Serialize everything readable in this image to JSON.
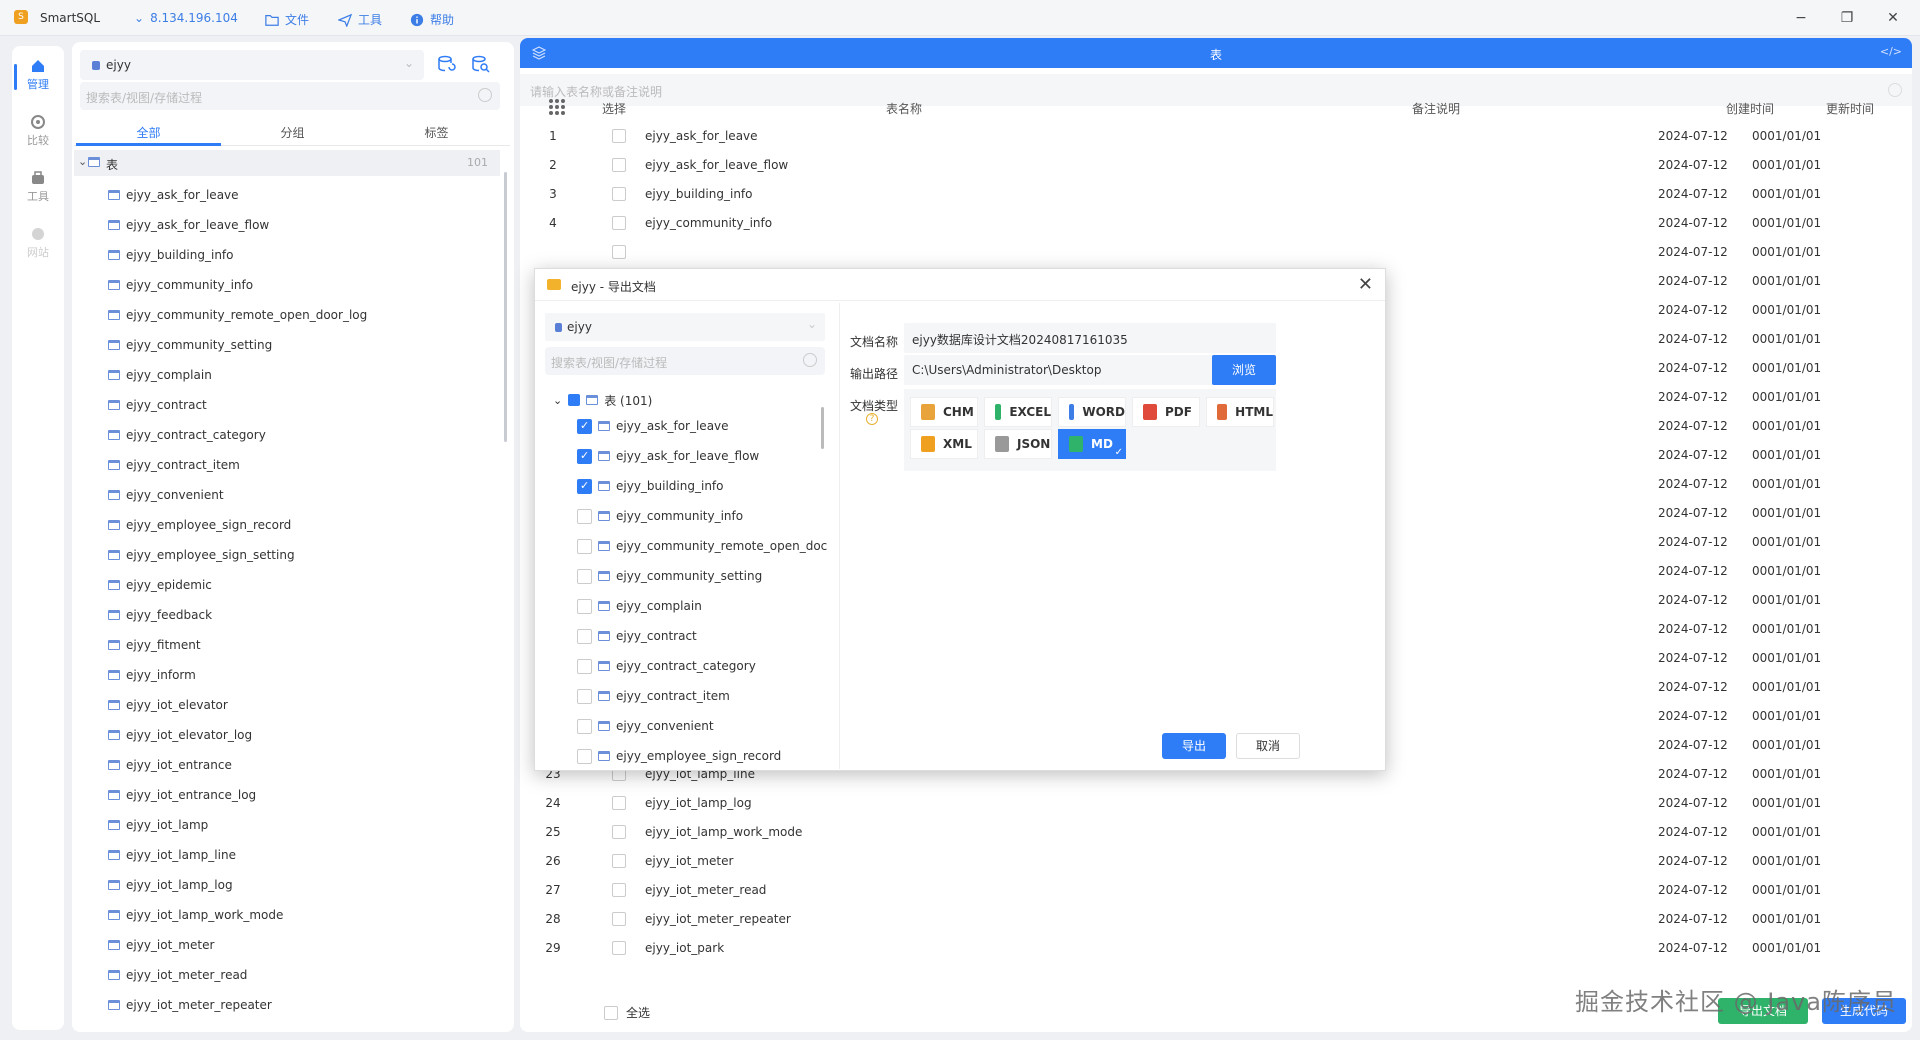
{
  "app": {
    "name": "SmartSQL",
    "connection": "8.134.196.104",
    "menu": [
      "文件",
      "工具",
      "帮助"
    ]
  },
  "sidenav": [
    {
      "label": "管理",
      "icon": "home-icon"
    },
    {
      "label": "比较",
      "icon": "compare-icon"
    },
    {
      "label": "工具",
      "icon": "toolbox-icon"
    },
    {
      "label": "网站",
      "icon": "globe-icon"
    }
  ],
  "left": {
    "db": "ejyy",
    "search_placeholder": "搜索表/视图/存储过程",
    "tabs": [
      "全部",
      "分组",
      "标签"
    ],
    "root_label": "表",
    "root_count": "101",
    "items": [
      "ejyy_ask_for_leave",
      "ejyy_ask_for_leave_flow",
      "ejyy_building_info",
      "ejyy_community_info",
      "ejyy_community_remote_open_door_log",
      "ejyy_community_setting",
      "ejyy_complain",
      "ejyy_contract",
      "ejyy_contract_category",
      "ejyy_contract_item",
      "ejyy_convenient",
      "ejyy_employee_sign_record",
      "ejyy_employee_sign_setting",
      "ejyy_epidemic",
      "ejyy_feedback",
      "ejyy_fitment",
      "ejyy_inform",
      "ejyy_iot_elevator",
      "ejyy_iot_elevator_log",
      "ejyy_iot_entrance",
      "ejyy_iot_entrance_log",
      "ejyy_iot_lamp",
      "ejyy_iot_lamp_line",
      "ejyy_iot_lamp_log",
      "ejyy_iot_lamp_work_mode",
      "ejyy_iot_meter",
      "ejyy_iot_meter_read",
      "ejyy_iot_meter_repeater"
    ]
  },
  "main": {
    "title": "表",
    "search_placeholder": "请输入表名称或备注说明",
    "headers": {
      "select": "选择",
      "name": "表名称",
      "comment": "备注说明",
      "created": "创建时间",
      "updated": "更新时间"
    },
    "rows": [
      {
        "no": "1",
        "name": "ejyy_ask_for_leave",
        "created": "2024-07-12",
        "updated": "0001/01/01"
      },
      {
        "no": "2",
        "name": "ejyy_ask_for_leave_flow",
        "created": "2024-07-12",
        "updated": "0001/01/01"
      },
      {
        "no": "3",
        "name": "ejyy_building_info",
        "created": "2024-07-12",
        "updated": "0001/01/01"
      },
      {
        "no": "4",
        "name": "ejyy_community_info",
        "created": "2024-07-12",
        "updated": "0001/01/01"
      },
      {
        "no": "",
        "name": "",
        "created": "2024-07-12",
        "updated": "0001/01/01"
      },
      {
        "no": "",
        "name": "",
        "created": "2024-07-12",
        "updated": "0001/01/01"
      },
      {
        "no": "",
        "name": "",
        "created": "2024-07-12",
        "updated": "0001/01/01"
      },
      {
        "no": "",
        "name": "",
        "created": "2024-07-12",
        "updated": "0001/01/01"
      },
      {
        "no": "",
        "name": "",
        "created": "2024-07-12",
        "updated": "0001/01/01"
      },
      {
        "no": "",
        "name": "",
        "created": "2024-07-12",
        "updated": "0001/01/01"
      },
      {
        "no": "",
        "name": "",
        "created": "2024-07-12",
        "updated": "0001/01/01"
      },
      {
        "no": "",
        "name": "",
        "created": "2024-07-12",
        "updated": "0001/01/01"
      },
      {
        "no": "",
        "name": "",
        "created": "2024-07-12",
        "updated": "0001/01/01"
      },
      {
        "no": "",
        "name": "",
        "created": "2024-07-12",
        "updated": "0001/01/01"
      },
      {
        "no": "",
        "name": "",
        "created": "2024-07-12",
        "updated": "0001/01/01"
      },
      {
        "no": "",
        "name": "",
        "created": "2024-07-12",
        "updated": "0001/01/01"
      },
      {
        "no": "",
        "name": "",
        "created": "2024-07-12",
        "updated": "0001/01/01"
      },
      {
        "no": "",
        "name": "",
        "created": "2024-07-12",
        "updated": "0001/01/01"
      },
      {
        "no": "",
        "name": "",
        "created": "2024-07-12",
        "updated": "0001/01/01"
      },
      {
        "no": "",
        "name": "",
        "created": "2024-07-12",
        "updated": "0001/01/01"
      },
      {
        "no": "",
        "name": "",
        "created": "2024-07-12",
        "updated": "0001/01/01"
      },
      {
        "no": "",
        "name": "",
        "created": "2024-07-12",
        "updated": "0001/01/01"
      },
      {
        "no": "23",
        "name": "ejyy_iot_lamp_line",
        "created": "2024-07-12",
        "updated": "0001/01/01"
      },
      {
        "no": "24",
        "name": "ejyy_iot_lamp_log",
        "created": "2024-07-12",
        "updated": "0001/01/01"
      },
      {
        "no": "25",
        "name": "ejyy_iot_lamp_work_mode",
        "created": "2024-07-12",
        "updated": "0001/01/01"
      },
      {
        "no": "26",
        "name": "ejyy_iot_meter",
        "created": "2024-07-12",
        "updated": "0001/01/01"
      },
      {
        "no": "27",
        "name": "ejyy_iot_meter_read",
        "created": "2024-07-12",
        "updated": "0001/01/01"
      },
      {
        "no": "28",
        "name": "ejyy_iot_meter_repeater",
        "created": "2024-07-12",
        "updated": "0001/01/01"
      },
      {
        "no": "29",
        "name": "ejyy_iot_park",
        "created": "2024-07-12",
        "updated": "0001/01/01"
      }
    ],
    "select_all": "全选",
    "export_doc_btn": "导出文档",
    "gen_code_btn": "生成代码"
  },
  "dialog": {
    "title": "ejyy - 导出文档",
    "db": "ejyy",
    "search_placeholder": "搜索表/视图/存储过程",
    "root_label": "表 (101)",
    "items": [
      {
        "name": "ejyy_ask_for_leave",
        "checked": true
      },
      {
        "name": "ejyy_ask_for_leave_flow",
        "checked": true
      },
      {
        "name": "ejyy_building_info",
        "checked": true
      },
      {
        "name": "ejyy_community_info",
        "checked": false
      },
      {
        "name": "ejyy_community_remote_open_doc",
        "checked": false
      },
      {
        "name": "ejyy_community_setting",
        "checked": false
      },
      {
        "name": "ejyy_complain",
        "checked": false
      },
      {
        "name": "ejyy_contract",
        "checked": false
      },
      {
        "name": "ejyy_contract_category",
        "checked": false
      },
      {
        "name": "ejyy_contract_item",
        "checked": false
      },
      {
        "name": "ejyy_convenient",
        "checked": false
      },
      {
        "name": "ejyy_employee_sign_record",
        "checked": false
      }
    ],
    "doc_name_label": "文档名称",
    "doc_name_value": "ejyy数据库设计文档20240817161035",
    "output_label": "输出路径",
    "output_value": "C:\\Users\\Administrator\\Desktop",
    "browse": "浏览",
    "type_label": "文档类型",
    "help": "?",
    "formats": [
      {
        "name": "CHM",
        "color": "#e8a33a"
      },
      {
        "name": "EXCEL",
        "color": "#2fb36a"
      },
      {
        "name": "WORD",
        "color": "#3d7ee6"
      },
      {
        "name": "PDF",
        "color": "#e04a3a"
      },
      {
        "name": "HTML",
        "color": "#e06a3a"
      },
      {
        "name": "XML",
        "color": "#f0a020"
      },
      {
        "name": "JSON",
        "color": "#999999"
      },
      {
        "name": "MD",
        "color": "#2fb36a"
      }
    ],
    "selected_format": "MD",
    "export": "导出",
    "cancel": "取消"
  },
  "watermark": "掘金技术社区 @ Java陈序员"
}
